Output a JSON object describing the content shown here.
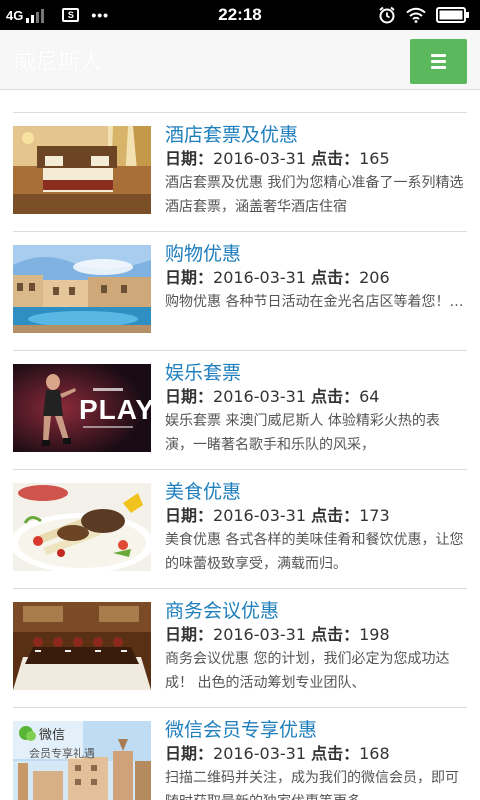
{
  "status_bar": {
    "network": "4G",
    "sim_label": "S",
    "more": "•••",
    "time": "22:18"
  },
  "header": {
    "brand": "威尼斯人"
  },
  "labels": {
    "date": "日期：",
    "clicks": "点击："
  },
  "items": [
    {
      "title": "酒店套票及优惠",
      "date": "2016-03-31",
      "clicks": "165",
      "desc": "酒店套票及优惠 我们为您精心准备了一系列精选酒店套票，涵盖奢华酒店住宿"
    },
    {
      "title": "购物优惠",
      "date": "2016-03-31",
      "clicks": "206",
      "desc": "购物优惠 各种节日活动在金光名店区等着您！…"
    },
    {
      "title": "娱乐套票",
      "date": "2016-03-31",
      "clicks": "64",
      "desc": "娱乐套票 来澳门威尼斯人 体验精彩火热的表演，一睹著名歌手和乐队的风采，",
      "image_text": "PLAY"
    },
    {
      "title": "美食优惠",
      "date": "2016-03-31",
      "clicks": "173",
      "desc": "美食优惠 各式各样的美味佳肴和餐饮优惠，让您的味蕾极致享受，满载而归。"
    },
    {
      "title": "商务会议优惠",
      "date": "2016-03-31",
      "clicks": "198",
      "desc": "商务会议优惠 您的计划，我们必定为您成功达成！ 出色的活动筹划专业团队、"
    },
    {
      "title": "微信会员专享优惠",
      "date": "2016-03-31",
      "clicks": "168",
      "desc": "扫描二维码并关注，成为我们的微信会员，即可随时获取最新的独家优惠等更多",
      "image_text": "微信",
      "image_subtext": "会员专享礼遇"
    }
  ],
  "colors": {
    "title": "#1f7fbd",
    "menu_button": "#5cb85c",
    "status_bar": "#000000"
  },
  "icons": {
    "status_left": [
      "signal-icon",
      "sim-icon"
    ],
    "status_right": [
      "alarm-icon",
      "wifi-icon",
      "battery-icon"
    ],
    "header": [
      "menu-icon"
    ]
  }
}
